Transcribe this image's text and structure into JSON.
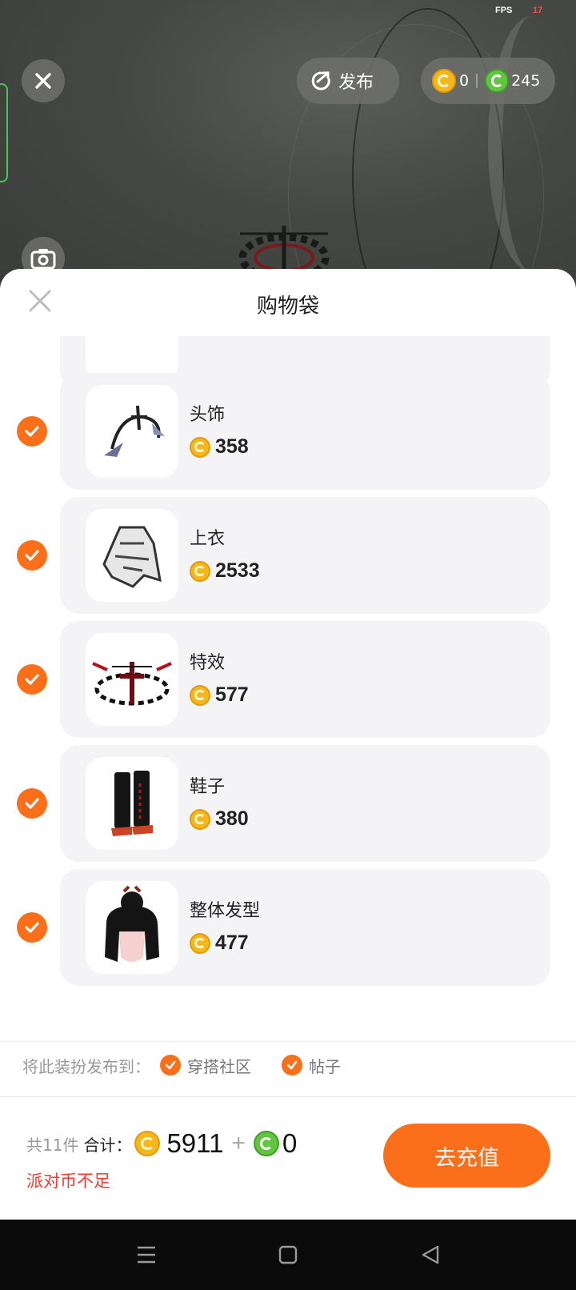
{
  "hud": {
    "fps_label": "FPS",
    "fps_value": "17",
    "publish_label": "发布",
    "gold_balance": "0",
    "green_balance": "245"
  },
  "sheet": {
    "title": "购物袋",
    "items": [
      {
        "name": "头饰",
        "price": "358",
        "checked": true
      },
      {
        "name": "上衣",
        "price": "2533",
        "checked": true
      },
      {
        "name": "特效",
        "price": "577",
        "checked": true
      },
      {
        "name": "鞋子",
        "price": "380",
        "checked": true
      },
      {
        "name": "整体发型",
        "price": "477",
        "checked": true
      }
    ],
    "publish_to": {
      "label": "将此装扮发布到：",
      "options": [
        "穿搭社区",
        "帖子"
      ]
    }
  },
  "footer": {
    "count": "共11件",
    "total_label": "合计：",
    "gold_total": "5911",
    "plus": "+",
    "green_total": "0",
    "warning": "派对币不足",
    "recharge_label": "去充值"
  },
  "colors": {
    "accent": "#fb6f1b",
    "warning": "#ef3b32",
    "gold_coin": "#f5b71c",
    "green_coin": "#62c540"
  }
}
